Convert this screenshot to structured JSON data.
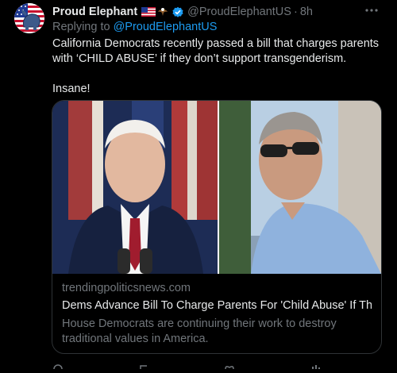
{
  "tweet": {
    "author_name": "Proud Elephant",
    "handle": "@ProudElephantUS",
    "dot": "·",
    "time": "8h",
    "replying_prefix": "Replying to",
    "replying_to": "@ProudElephantUS",
    "text_line1": "California Democrats recently passed a bill that charges parents with ‘CHILD ABUSE’ if they don’t support transgenderism.",
    "text_line2": "Insane!",
    "icons": [
      "us-flag-icon",
      "eagle-icon",
      "verified-badge-icon",
      "more-options-icon"
    ]
  },
  "card": {
    "domain": "trendingpoliticsnews.com",
    "title": "Dems Advance Bill To Charge Parents For 'Child Abuse' If Th...",
    "description": "House Democrats are continuing their work to destroy traditional values in America."
  },
  "colors": {
    "background": "#000000",
    "text": "#e7e9ea",
    "muted": "#71767b",
    "link": "#1d9bf0",
    "border": "#2f3336"
  }
}
